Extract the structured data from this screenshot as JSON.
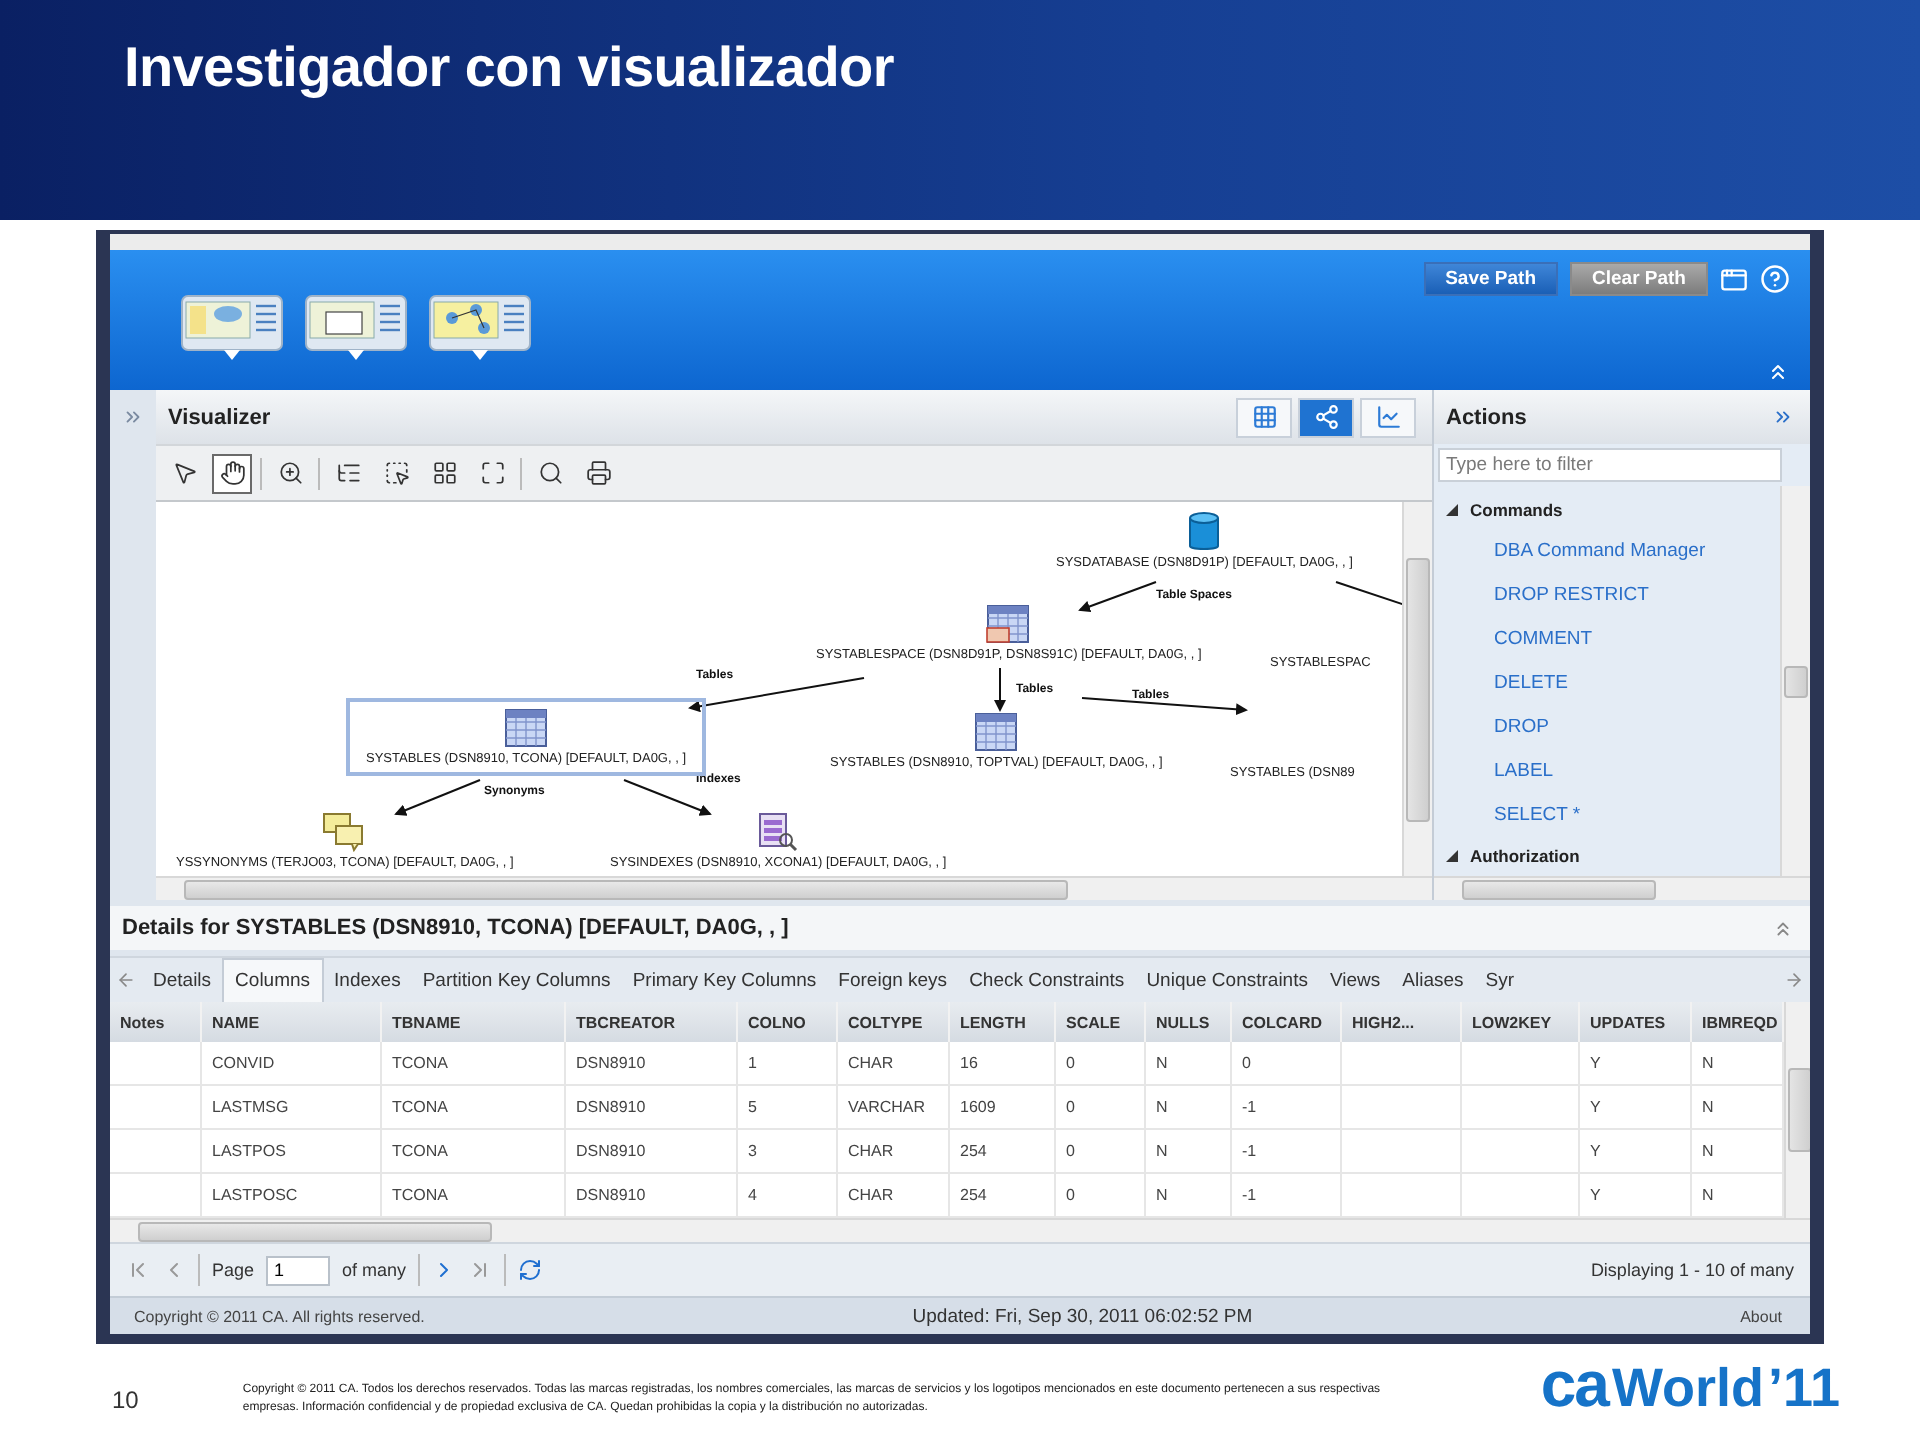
{
  "slide": {
    "title": "Investigador con visualizador",
    "page_number": "10",
    "copyright": "Copyright © 2011 CA. Todos los derechos reservados. Todas las marcas registradas, los nombres comerciales, las marcas de servicios y los logotipos mencionados en este documento pertenecen a sus respectivas empresas. Información confidencial y de propiedad exclusiva de CA. Quedan prohibidas la copia y la distribución no autorizadas.",
    "logo": {
      "mark": "ca",
      "name": "World",
      "year": "’11"
    }
  },
  "app": {
    "toolbar": {
      "buttons": [
        {
          "label": "Save Path",
          "disabled": false
        },
        {
          "label": "Clear Path",
          "disabled": true
        }
      ]
    },
    "visualizer": {
      "title": "Visualizer",
      "view_modes": [
        {
          "kind": "grid",
          "selected": false
        },
        {
          "kind": "graph",
          "selected": true
        },
        {
          "kind": "chart",
          "selected": false
        }
      ],
      "tools": [
        {
          "kind": "pointer",
          "selected": false
        },
        {
          "kind": "hand",
          "selected": true
        },
        {
          "kind": "zoom",
          "selected": false
        },
        {
          "kind": "tree",
          "selected": false
        },
        {
          "kind": "select",
          "selected": false
        },
        {
          "kind": "layout",
          "selected": false
        },
        {
          "kind": "fit",
          "selected": false
        },
        {
          "kind": "find",
          "selected": false
        },
        {
          "kind": "print",
          "selected": false
        }
      ],
      "nodes": [
        {
          "kind": "database",
          "label": "SYSDATABASE (DSN8D91P) [DEFAULT, DA0G, , ]",
          "selected": false
        },
        {
          "kind": "tablespace",
          "label": "SYSTABLESPACE (DSN8D91P, DSN8S91C) [DEFAULT, DA0G, , ]",
          "selected": false
        },
        {
          "kind": "label_only",
          "label": "SYSTABLESPAC",
          "selected": false
        },
        {
          "kind": "table",
          "label": "SYSTABLES (DSN8910, TCONA) [DEFAULT, DA0G, , ]",
          "selected": true
        },
        {
          "kind": "table",
          "label": "SYSTABLES (DSN8910, TOPTVAL) [DEFAULT, DA0G, , ]",
          "selected": false
        },
        {
          "kind": "label_only",
          "label": "SYSTABLES (DSN89",
          "selected": false
        },
        {
          "kind": "synonym",
          "label": "YSSYNONYMS (TERJO03, TCONA) [DEFAULT, DA0G, , ]",
          "selected": false
        },
        {
          "kind": "index",
          "label": "SYSINDEXES (DSN8910, XCONA1) [DEFAULT, DA0G, , ]",
          "selected": false
        }
      ],
      "edges": [
        {
          "kind": "arrow",
          "label": "Table Spaces"
        },
        {
          "kind": "line"
        },
        {
          "kind": "arrow",
          "label": "Tables"
        },
        {
          "kind": "arrow",
          "label": "Tables"
        },
        {
          "kind": "arrow",
          "label": "Tables"
        },
        {
          "kind": "arrow",
          "label": "Synonyms"
        },
        {
          "kind": "arrow",
          "label": "Indexes"
        }
      ]
    },
    "actions": {
      "title": "Actions",
      "filter_placeholder": "Type here to filter",
      "groups": [
        {
          "label": "Commands",
          "expanded": true,
          "items": [
            "DBA Command Manager",
            "DROP RESTRICT",
            "COMMENT",
            "DELETE",
            "DROP",
            "LABEL",
            "SELECT *"
          ]
        },
        {
          "label": "Authorization",
          "expanded": true
        }
      ]
    },
    "details": {
      "title": "Details for SYSTABLES (DSN8910, TCONA) [DEFAULT, DA0G, , ]",
      "tabs": [
        {
          "label": "Details",
          "selected": false
        },
        {
          "label": "Columns",
          "selected": true
        },
        {
          "label": "Indexes",
          "selected": false
        },
        {
          "label": "Partition Key Columns",
          "selected": false
        },
        {
          "label": "Primary Key Columns",
          "selected": false
        },
        {
          "label": "Foreign keys",
          "selected": false
        },
        {
          "label": "Check Constraints",
          "selected": false
        },
        {
          "label": "Unique Constraints",
          "selected": false
        },
        {
          "label": "Views",
          "selected": false
        },
        {
          "label": "Aliases",
          "selected": false
        },
        {
          "label": "Syr",
          "selected": false
        }
      ],
      "table": {
        "columns": [
          "Notes",
          "NAME",
          "TBNAME",
          "TBCREATOR",
          "COLNO",
          "COLTYPE",
          "LENGTH",
          "SCALE",
          "NULLS",
          "COLCARD",
          "HIGH2...",
          "LOW2KEY",
          "UPDATES",
          "IBMREQD"
        ],
        "rows": [
          [
            null,
            "CONVID",
            "TCONA",
            "DSN8910",
            "1",
            "CHAR",
            "16",
            "0",
            "N",
            "0",
            null,
            null,
            "Y",
            "N"
          ],
          [
            null,
            "LASTMSG",
            "TCONA",
            "DSN8910",
            "5",
            "VARCHAR",
            "1609",
            "0",
            "N",
            "-1",
            null,
            null,
            "Y",
            "N"
          ],
          [
            null,
            "LASTPOS",
            "TCONA",
            "DSN8910",
            "3",
            "CHAR",
            "254",
            "0",
            "N",
            "-1",
            null,
            null,
            "Y",
            "N"
          ],
          [
            null,
            "LASTPOSC",
            "TCONA",
            "DSN8910",
            "4",
            "CHAR",
            "254",
            "0",
            "N",
            "-1",
            null,
            null,
            "Y",
            "N"
          ]
        ]
      },
      "pager": {
        "page_label": "Page",
        "page": "1",
        "of_label": "of many",
        "summary": "Displaying 1 - 10 of many"
      }
    },
    "status_bar": {
      "copyright": "Copyright © 2011 CA. All rights reserved.",
      "updated": "Updated: Fri, Sep 30, 2011 06:02:52 PM",
      "about": "About"
    }
  }
}
